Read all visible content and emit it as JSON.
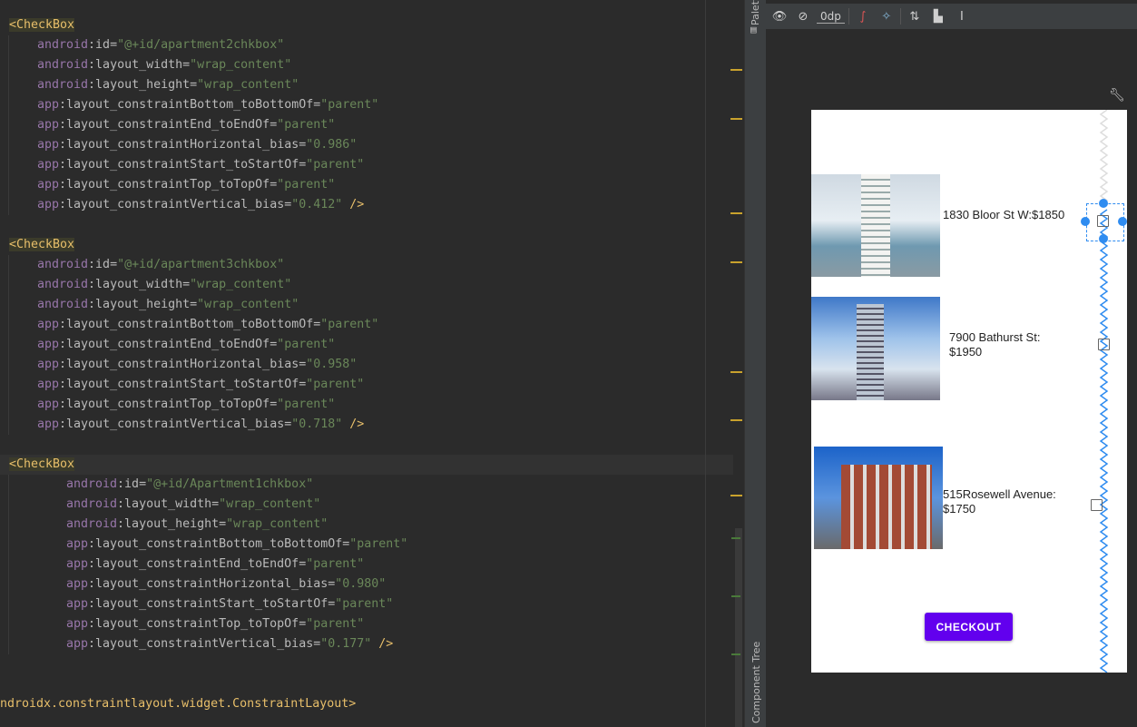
{
  "editor": {
    "blocks": [
      {
        "tag": "<CheckBox",
        "attrs": [
          [
            "android",
            ":id=",
            "\"@+id/apartment2chkbox\""
          ],
          [
            "android",
            ":layout_width=",
            "\"wrap_content\""
          ],
          [
            "android",
            ":layout_height=",
            "\"wrap_content\""
          ],
          [
            "app",
            ":layout_constraintBottom_toBottomOf=",
            "\"parent\""
          ],
          [
            "app",
            ":layout_constraintEnd_toEndOf=",
            "\"parent\""
          ],
          [
            "app",
            ":layout_constraintHorizontal_bias=",
            "\"0.986\""
          ],
          [
            "app",
            ":layout_constraintStart_toStartOf=",
            "\"parent\""
          ],
          [
            "app",
            ":layout_constraintTop_toTopOf=",
            "\"parent\""
          ],
          [
            "app",
            ":layout_constraintVertical_bias=",
            "\"0.412\""
          ]
        ]
      },
      {
        "tag": "<CheckBox",
        "attrs": [
          [
            "android",
            ":id=",
            "\"@+id/apartment3chkbox\""
          ],
          [
            "android",
            ":layout_width=",
            "\"wrap_content\""
          ],
          [
            "android",
            ":layout_height=",
            "\"wrap_content\""
          ],
          [
            "app",
            ":layout_constraintBottom_toBottomOf=",
            "\"parent\""
          ],
          [
            "app",
            ":layout_constraintEnd_toEndOf=",
            "\"parent\""
          ],
          [
            "app",
            ":layout_constraintHorizontal_bias=",
            "\"0.958\""
          ],
          [
            "app",
            ":layout_constraintStart_toStartOf=",
            "\"parent\""
          ],
          [
            "app",
            ":layout_constraintTop_toTopOf=",
            "\"parent\""
          ],
          [
            "app",
            ":layout_constraintVertical_bias=",
            "\"0.718\""
          ]
        ]
      },
      {
        "tag": "<CheckBox",
        "attrs": [
          [
            "android",
            ":id=",
            "\"@+id/Apartment1chkbox\""
          ],
          [
            "android",
            ":layout_width=",
            "\"wrap_content\""
          ],
          [
            "android",
            ":layout_height=",
            "\"wrap_content\""
          ],
          [
            "app",
            ":layout_constraintBottom_toBottomOf=",
            "\"parent\""
          ],
          [
            "app",
            ":layout_constraintEnd_toEndOf=",
            "\"parent\""
          ],
          [
            "app",
            ":layout_constraintHorizontal_bias=",
            "\"0.980\""
          ],
          [
            "app",
            ":layout_constraintStart_toStartOf=",
            "\"parent\""
          ],
          [
            "app",
            ":layout_constraintTop_toTopOf=",
            "\"parent\""
          ],
          [
            "app",
            ":layout_constraintVertical_bias=",
            "\"0.177\""
          ]
        ]
      }
    ],
    "close_tag": " />",
    "closing_line": "ndroidx.constraintlayout.widget.ConstraintLayout>"
  },
  "side_tabs": {
    "palette": "Palette",
    "component_tree": "Component Tree"
  },
  "toolbar": {
    "margin_value": "0dp"
  },
  "preview": {
    "items": [
      {
        "label": "1830 Bloor St W:$1850"
      },
      {
        "label": "7900 Bathurst St:\n$1950"
      },
      {
        "label": "515Rosewell Avenue:\n$1750"
      }
    ],
    "checkout_label": "CHECKOUT",
    "accent": "#6200ee",
    "selection_color": "#2f8cf0"
  }
}
